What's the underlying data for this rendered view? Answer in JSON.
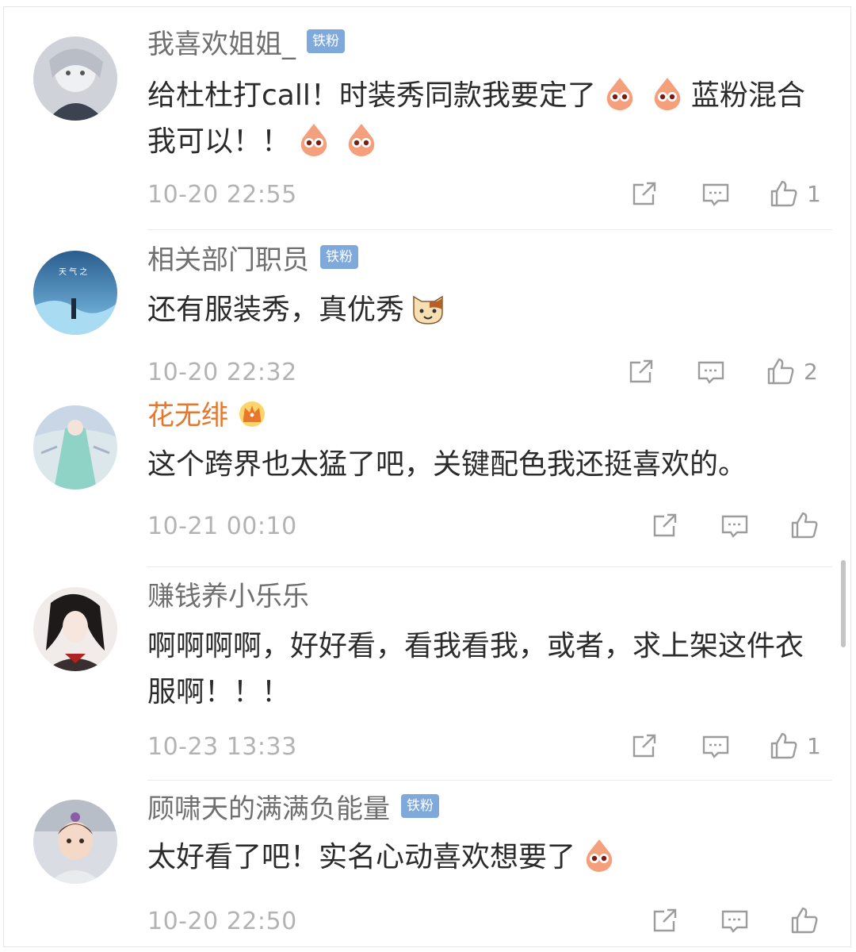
{
  "comments": [
    {
      "username": "我喜欢姐姐_",
      "badge": "铁粉",
      "text_parts": [
        "给杜杜打call！时装秀同款我要定了",
        "蓝粉混合我可以！！"
      ],
      "emoji": [
        "pink-drop-emoji",
        "cat-emoji"
      ],
      "time": "10-20 22:55",
      "likes": "1"
    },
    {
      "username": "相关部门职员",
      "badge": "铁粉",
      "text": "还有服装秀，真优秀",
      "time": "10-20 22:32",
      "likes": "2"
    },
    {
      "username": "花无绯",
      "text": "这个跨界也太猛了吧，关键配色我还挺喜欢的。",
      "time": "10-21 00:10",
      "likes": ""
    },
    {
      "username": "赚钱养小乐乐",
      "text": "啊啊啊啊，好好看，看我看我，或者，求上架这件衣服啊！！！",
      "time": "10-23 13:33",
      "likes": "1"
    },
    {
      "username": "顾啸天的满满负能量",
      "badge": "铁粉",
      "text": "太好看了吧！实名心动喜欢想要了",
      "time": "10-20 22:50",
      "likes": ""
    }
  ],
  "colors": {
    "username": "#6f6f6f",
    "vip_username": "#e8762c",
    "badge_bg": "#7fa9da",
    "time": "#b3b3b3",
    "icon": "#9c9c9c"
  }
}
